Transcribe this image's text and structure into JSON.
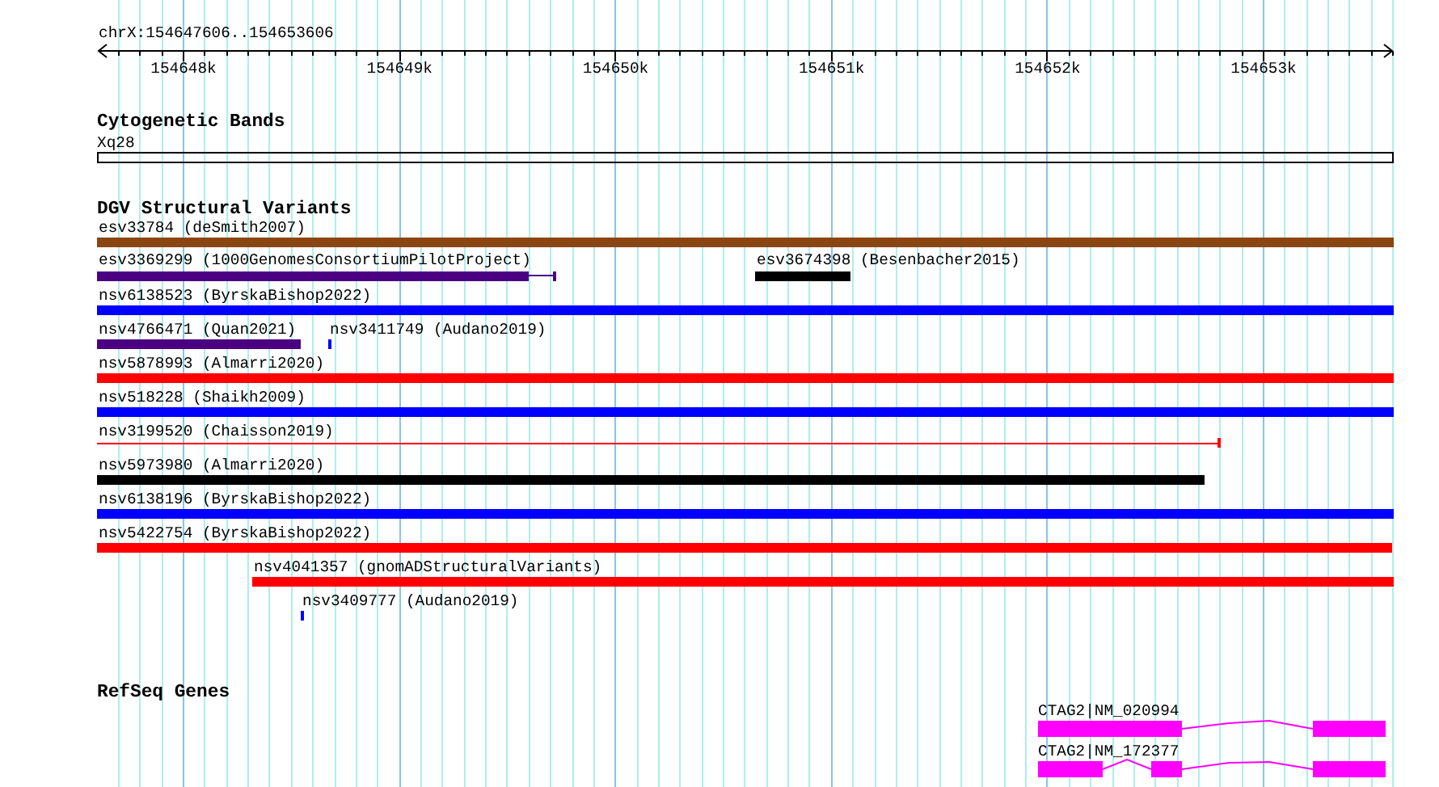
{
  "location": "chrX:154647606..154653606",
  "ruler": {
    "ticks": [
      "154648k",
      "154649k",
      "154650k",
      "154651k",
      "154652k",
      "154653k"
    ]
  },
  "tracks": [
    {
      "title": "Cytogenetic Bands",
      "kind": "bands",
      "features": [
        {
          "label": "Xq28"
        }
      ]
    },
    {
      "title": "DGV Structural Variants",
      "kind": "variants",
      "features": [
        {
          "label": "esv33784 (deSmith2007)",
          "color": "#8b4513",
          "kind": "bar"
        },
        {
          "label": "esv3369299 (1000GenomesConsortiumPilotProject)",
          "color": "#4b0082",
          "kind": "whisker"
        },
        {
          "label": "esv3674398 (Besenbacher2015)",
          "color": "#000000",
          "kind": "bar"
        },
        {
          "label": "nsv6138523 (ByrskaBishop2022)",
          "color": "#0000ff",
          "kind": "bar"
        },
        {
          "label": "nsv4766471 (Quan2021)",
          "color": "#4b0082",
          "kind": "bar"
        },
        {
          "label": "nsv3411749 (Audano2019)",
          "color": "#0000ff",
          "kind": "bar"
        },
        {
          "label": "nsv5878993 (Almarri2020)",
          "color": "#ff0000",
          "kind": "bar"
        },
        {
          "label": "nsv518228 (Shaikh2009)",
          "color": "#0000ff",
          "kind": "bar"
        },
        {
          "label": "nsv3199520 (Chaisson2019)",
          "color": "#ff0000",
          "kind": "line"
        },
        {
          "label": "nsv5973980 (Almarri2020)",
          "color": "#000000",
          "kind": "bar"
        },
        {
          "label": "nsv6138196 (ByrskaBishop2022)",
          "color": "#0000ff",
          "kind": "bar"
        },
        {
          "label": "nsv5422754 (ByrskaBishop2022)",
          "color": "#ff0000",
          "kind": "bar"
        },
        {
          "label": "nsv4041357 (gnomADStructuralVariants)",
          "color": "#ff0000",
          "kind": "bar"
        },
        {
          "label": "nsv3409777 (Audano2019)",
          "color": "#0000ff",
          "kind": "bar"
        }
      ]
    },
    {
      "title": "RefSeq Genes",
      "kind": "genes",
      "features": [
        {
          "label": "CTAG2|NM_020994"
        },
        {
          "label": "CTAG2|NM_172377"
        }
      ]
    }
  ]
}
